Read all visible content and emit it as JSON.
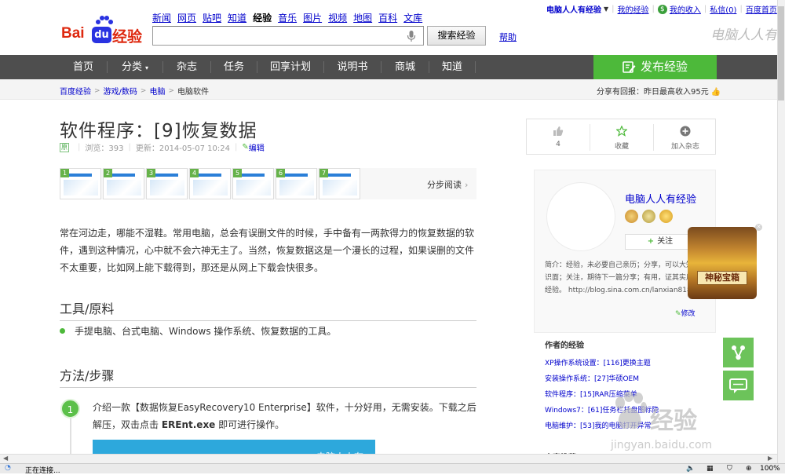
{
  "header": {
    "logo": {
      "part1": "Bai",
      "part2": "du",
      "part3": "经验"
    },
    "nav": [
      "新闻",
      "网页",
      "贴吧",
      "知道",
      "经验",
      "音乐",
      "图片",
      "视频",
      "地图",
      "百科",
      "文库"
    ],
    "active_nav": "经验",
    "search_value": "",
    "search_button": "搜索经验",
    "help": "帮助",
    "user_name": "电脑人人有经验",
    "user_links": [
      "我的经验",
      "我的收入",
      "私信(0)",
      "百度首页"
    ],
    "watermark": "电脑人人有"
  },
  "main_nav": {
    "items": [
      "首页",
      "分类",
      "杂志",
      "任务",
      "回享计划",
      "说明书",
      "商城",
      "知道"
    ],
    "publish": "发布经验"
  },
  "breadcrumb": [
    "百度经验",
    "游戏/数码",
    "电脑",
    "电脑软件"
  ],
  "share_promo": {
    "label": "分享有回报：",
    "value": "昨日最高收入95元"
  },
  "article": {
    "title": "软件程序：[9]恢复数据",
    "original_tag": "原",
    "views_label": "浏览：393",
    "updated_label": "更新：2014-05-07 10:24",
    "edit": "编辑",
    "thumb_count": 7,
    "step_view": "分步阅读",
    "intro": "常在河边走，哪能不湿鞋。常用电脑，总会有误删文件的时候，手中备有一两款得力的恢复数据的软件，遇到这种情况，心中就不会六神无主了。当然，恢复数据这是一个漫长的过程，如果误删的文件不太重要，比如网上能下载得到，那还是从网上下载会快很多。",
    "tools_title": "工具/原料",
    "tools": [
      "手提电脑、台式电脑、Windows 操作系统、恢复数据的工具。"
    ],
    "steps_title": "方法/步骤",
    "step1_number": "1",
    "step1_text_a": "介绍一款【数据恢复EasyRecovery10 Enterprise】软件，十分好用，无需安装。下载之后解压，双击点击 ",
    "step1_text_bold": "EREnt.exe",
    "step1_text_b": " 即可进行操作。",
    "step1_image_caption": "电脑人人有"
  },
  "actions": [
    {
      "icon": "thumbs-up-icon",
      "label": "4"
    },
    {
      "icon": "star-icon",
      "label": "收藏"
    },
    {
      "icon": "plus-icon",
      "label": "加入杂志"
    }
  ],
  "author": {
    "name": "电脑人人有经验",
    "follow": "关注",
    "bio": "简介：经验，未必要自己亲历；分享，可以大知识面；关注，期待下一篇分享；有用，证其实用经验。 http://blog.sina.com.cn/lanxian818",
    "edit": "修改"
  },
  "works": {
    "title": "作者的经验",
    "items": [
      "XP操作系统设置：[116]更换主题",
      "安装操作系统：[27]华硕OEM",
      "软件程序：[15]RAR压缩菜单",
      "Windows7：[61]任务栏托盘图标隐",
      "电脑维护：[53]我的电脑打开异常"
    ]
  },
  "recommend_title": "内容推荐",
  "treasure_label": "神秘宝箱",
  "bottom_watermark": {
    "text": "经验",
    "url": "jingyan.baidu.com"
  },
  "status": {
    "text": "正在连接...",
    "zoom": "100%"
  },
  "colors": {
    "green": "#4db93a",
    "nav_bg": "#4e4e4e",
    "link": "#0000cc",
    "logo_red": "#de2910",
    "logo_blue": "#2932e1"
  }
}
